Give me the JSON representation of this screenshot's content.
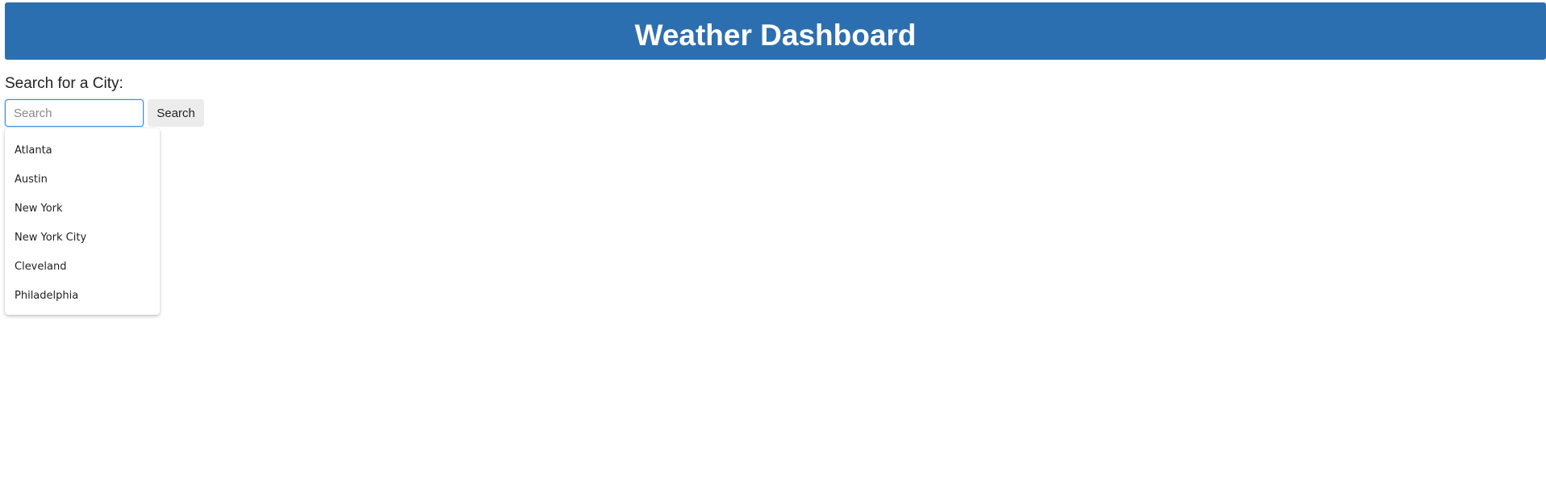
{
  "header": {
    "title": "Weather Dashboard",
    "background_color": "#2c6fb0"
  },
  "search": {
    "label": "Search for a City:",
    "placeholder": "Search",
    "value": "",
    "button_label": "Search",
    "suggestions": [
      {
        "label": "Atlanta"
      },
      {
        "label": "Austin"
      },
      {
        "label": "New York"
      },
      {
        "label": "New York City"
      },
      {
        "label": "Cleveland"
      },
      {
        "label": "Philadelphia"
      }
    ]
  }
}
